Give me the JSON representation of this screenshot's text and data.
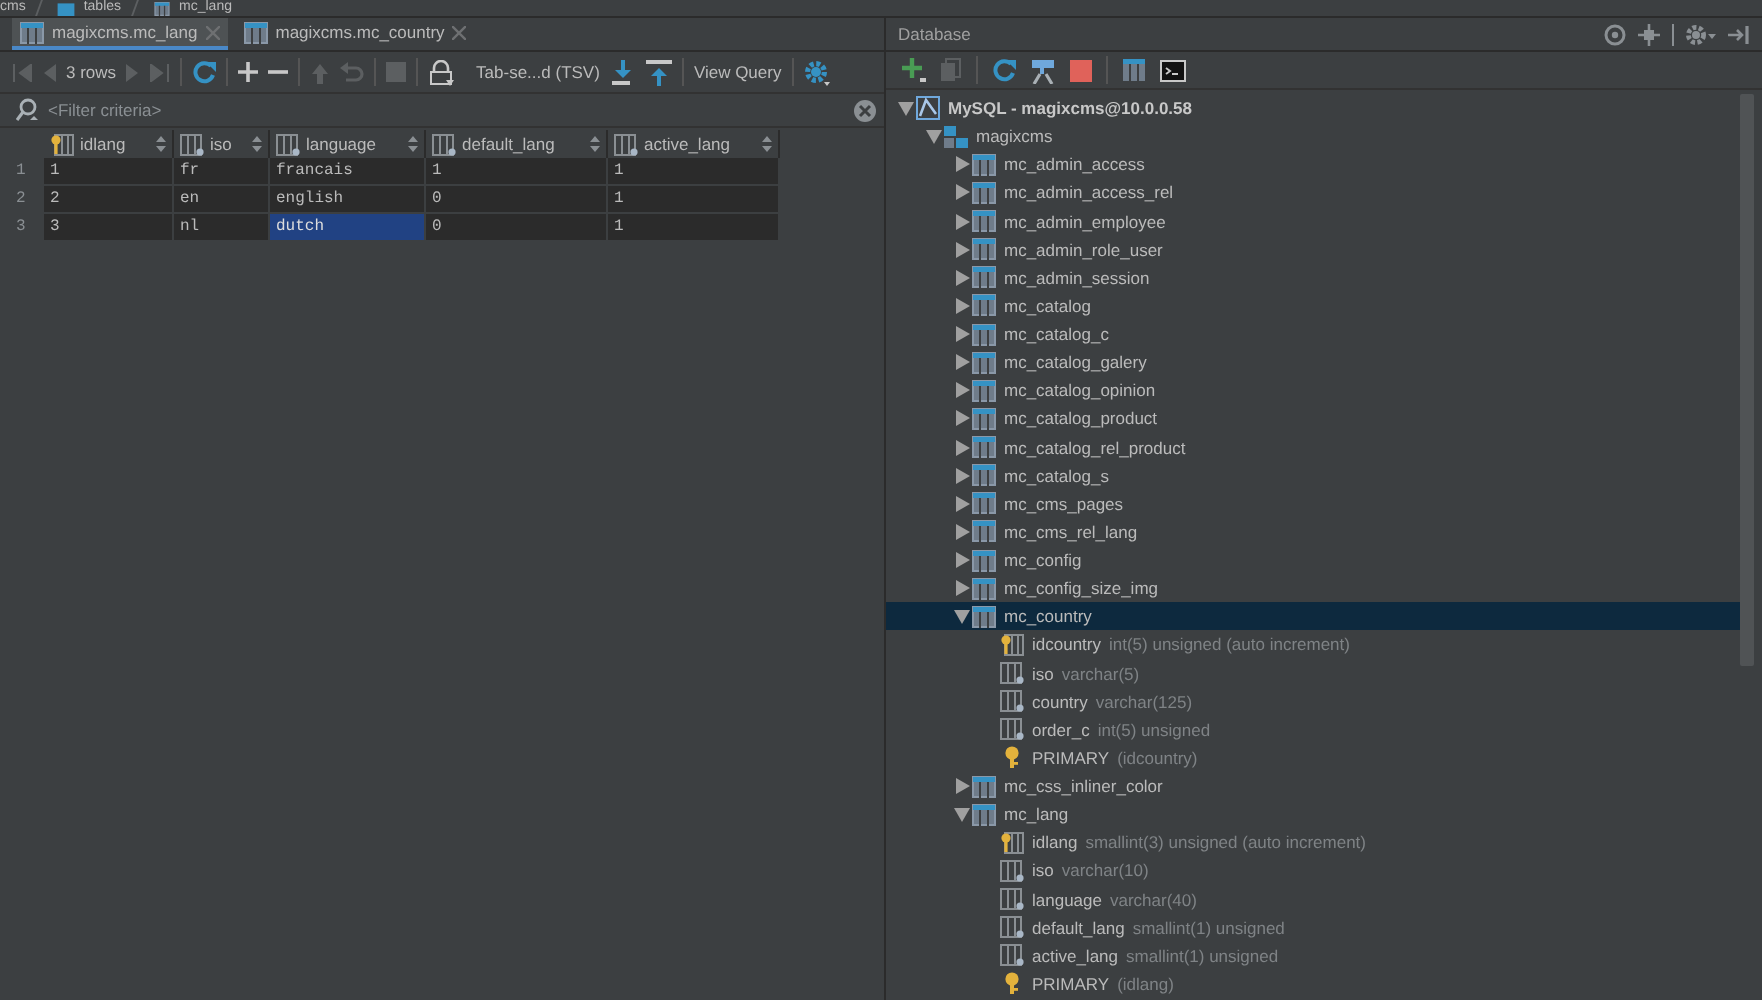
{
  "breadcrumb": [
    {
      "label": "cms",
      "kind": "schema"
    },
    {
      "label": "tables",
      "kind": "folder"
    },
    {
      "label": "mc_lang",
      "kind": "table"
    }
  ],
  "editor": {
    "tabs": [
      {
        "label": "magixcms.mc_lang",
        "selected": true
      },
      {
        "label": "magixcms.mc_country",
        "selected": false
      }
    ],
    "toolbar": {
      "row_count": "3 rows",
      "format": "Tab-se...d (TSV)",
      "view_query": "View Query"
    },
    "filter": {
      "placeholder": "<Filter criteria>"
    },
    "table": {
      "columns": [
        {
          "name": "idlang",
          "kind": "key"
        },
        {
          "name": "iso",
          "kind": "column"
        },
        {
          "name": "language",
          "kind": "column"
        },
        {
          "name": "default_lang",
          "kind": "column"
        },
        {
          "name": "active_lang",
          "kind": "column"
        }
      ],
      "rows": [
        {
          "number": "1",
          "cells": [
            {
              "text": "1",
              "selected": false
            },
            {
              "text": "fr",
              "selected": false
            },
            {
              "text": "francais",
              "selected": false
            },
            {
              "text": "1",
              "selected": false
            },
            {
              "text": "1",
              "selected": false
            }
          ]
        },
        {
          "number": "2",
          "cells": [
            {
              "text": "2",
              "selected": false
            },
            {
              "text": "en",
              "selected": false
            },
            {
              "text": "english",
              "selected": false
            },
            {
              "text": "0",
              "selected": false
            },
            {
              "text": "1",
              "selected": false
            }
          ]
        },
        {
          "number": "3",
          "cells": [
            {
              "text": "3",
              "selected": false
            },
            {
              "text": "nl",
              "selected": false
            },
            {
              "text": "dutch",
              "selected": true
            },
            {
              "text": "0",
              "selected": false
            },
            {
              "text": "1",
              "selected": false
            }
          ]
        }
      ]
    }
  },
  "database": {
    "title": "Database",
    "tree": [
      {
        "label": "MySQL - magixcms@10.0.0.58",
        "kind": "datasource",
        "expanded": true,
        "selected": false,
        "children": [
          {
            "label": "magixcms",
            "kind": "schema",
            "expanded": true,
            "selected": false,
            "children": [
              {
                "label": "mc_admin_access",
                "kind": "table",
                "expanded": false,
                "selected": false
              },
              {
                "label": "mc_admin_access_rel",
                "kind": "table",
                "expanded": false,
                "selected": false
              },
              {
                "label": "mc_admin_employee",
                "kind": "table",
                "expanded": false,
                "selected": false
              },
              {
                "label": "mc_admin_role_user",
                "kind": "table",
                "expanded": false,
                "selected": false
              },
              {
                "label": "mc_admin_session",
                "kind": "table",
                "expanded": false,
                "selected": false
              },
              {
                "label": "mc_catalog",
                "kind": "table",
                "expanded": false,
                "selected": false
              },
              {
                "label": "mc_catalog_c",
                "kind": "table",
                "expanded": false,
                "selected": false
              },
              {
                "label": "mc_catalog_galery",
                "kind": "table",
                "expanded": false,
                "selected": false
              },
              {
                "label": "mc_catalog_opinion",
                "kind": "table",
                "expanded": false,
                "selected": false
              },
              {
                "label": "mc_catalog_product",
                "kind": "table",
                "expanded": false,
                "selected": false
              },
              {
                "label": "mc_catalog_rel_product",
                "kind": "table",
                "expanded": false,
                "selected": false
              },
              {
                "label": "mc_catalog_s",
                "kind": "table",
                "expanded": false,
                "selected": false
              },
              {
                "label": "mc_cms_pages",
                "kind": "table",
                "expanded": false,
                "selected": false
              },
              {
                "label": "mc_cms_rel_lang",
                "kind": "table",
                "expanded": false,
                "selected": false
              },
              {
                "label": "mc_config",
                "kind": "table",
                "expanded": false,
                "selected": false
              },
              {
                "label": "mc_config_size_img",
                "kind": "table",
                "expanded": false,
                "selected": false
              },
              {
                "label": "mc_country",
                "kind": "table",
                "expanded": true,
                "selected": true,
                "children": [
                  {
                    "label": "idcountry",
                    "type": "int(5) unsigned (auto increment)",
                    "kind": "key_column",
                    "selected": false
                  },
                  {
                    "label": "iso",
                    "type": "varchar(5)",
                    "kind": "column",
                    "selected": false
                  },
                  {
                    "label": "country",
                    "type": "varchar(125)",
                    "kind": "column",
                    "selected": false
                  },
                  {
                    "label": "order_c",
                    "type": "int(5) unsigned",
                    "kind": "column",
                    "selected": false
                  },
                  {
                    "label": "PRIMARY",
                    "type": "(idcountry)",
                    "kind": "index",
                    "selected": false
                  }
                ]
              },
              {
                "label": "mc_css_inliner_color",
                "kind": "table",
                "expanded": false,
                "selected": false
              },
              {
                "label": "mc_lang",
                "kind": "table",
                "expanded": true,
                "selected": false,
                "children": [
                  {
                    "label": "idlang",
                    "type": "smallint(3) unsigned (auto increment)",
                    "kind": "key_column",
                    "selected": false
                  },
                  {
                    "label": "iso",
                    "type": "varchar(10)",
                    "kind": "column",
                    "selected": false
                  },
                  {
                    "label": "language",
                    "type": "varchar(40)",
                    "kind": "column",
                    "selected": false
                  },
                  {
                    "label": "default_lang",
                    "type": "smallint(1) unsigned",
                    "kind": "column",
                    "selected": false
                  },
                  {
                    "label": "active_lang",
                    "type": "smallint(1) unsigned",
                    "kind": "column",
                    "selected": false
                  },
                  {
                    "label": "PRIMARY",
                    "type": "(idlang)",
                    "kind": "index",
                    "selected": false
                  }
                ]
              }
            ]
          }
        ]
      }
    ]
  }
}
